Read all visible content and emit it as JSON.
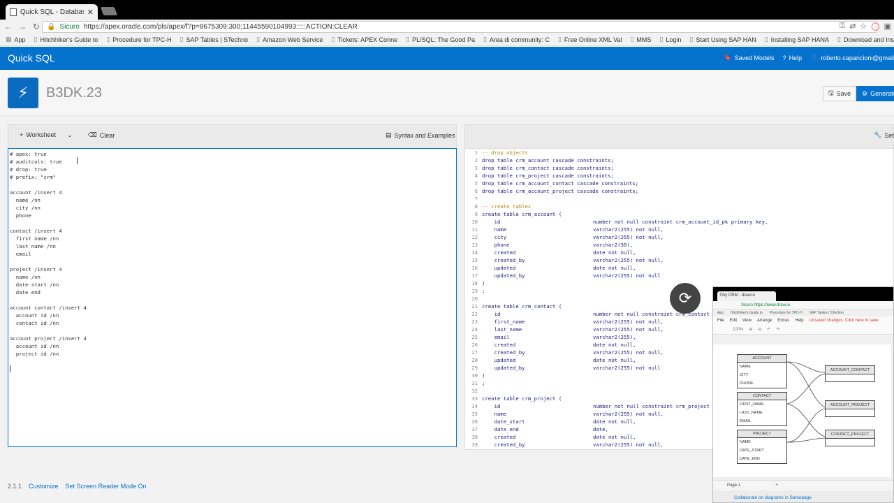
{
  "browser": {
    "tab_title": "Quick SQL - Database To",
    "secure_label": "Sicuro",
    "url": "https://apex.oracle.com/pls/apex/f?p=8675309:300:11445590104993:::::ACTION:CLEAR",
    "bookmarks": [
      "App",
      "Hitchhiker's Guide to",
      "Procedure for TPC-H",
      "SAP Tables | STechno",
      "Amazon Web Service",
      "Tickets: APEX Conne",
      "PL/SQL: The Good Pa",
      "Area di community: C",
      "Free Online XML Val",
      "MMS",
      "Login",
      "Start Using SAP HAN",
      "Installing SAP HANA",
      "Download and Instal"
    ]
  },
  "header": {
    "brand": "Quick SQL",
    "saved_models": "Saved Models",
    "help": "Help",
    "user": "roberto.capancioni@gmail"
  },
  "hero": {
    "title": "B3DK.23",
    "save_label": "Save",
    "generate_label": "Generate"
  },
  "left_toolbar": {
    "worksheet_label": "Worksheet",
    "clear_label": "Clear",
    "syntax_label": "Syntax and Examples"
  },
  "right_toolbar": {
    "settings_label": "Setti"
  },
  "editor": {
    "lines": [
      "# apex: true",
      "# auditcols: true",
      "# drop: true",
      "# prefix: \"crm\"",
      "",
      "account /insert 4",
      "  name /nn",
      "  city /nn",
      "  phone",
      "",
      "contact /insert 4",
      "  first name /nn",
      "  last name /nn",
      "  email",
      "",
      "project /insert 4",
      "  name /nn",
      "  date start /nn",
      "  date end",
      "",
      "account contact /insert 4",
      "  account id /nn",
      "  contact id /nn",
      "",
      "account project /insert 4",
      "  account id /nn",
      "  project id /nn"
    ]
  },
  "output": {
    "rows": [
      {
        "n": "1",
        "code": "-- drop objects",
        "type": "",
        "cls": "cm"
      },
      {
        "n": "2",
        "code": "drop table crm_account cascade constraints;",
        "type": "",
        "cls": ""
      },
      {
        "n": "3",
        "code": "drop table crm_contact cascade constraints;",
        "type": "",
        "cls": ""
      },
      {
        "n": "4",
        "code": "drop table crm_project cascade constraints;",
        "type": "",
        "cls": ""
      },
      {
        "n": "5",
        "code": "drop table crm_account_contact cascade constraints;",
        "type": "",
        "cls": ""
      },
      {
        "n": "6",
        "code": "drop table crm_account_project cascade constraints;",
        "type": "",
        "cls": ""
      },
      {
        "n": "7",
        "code": "",
        "type": "",
        "cls": ""
      },
      {
        "n": "8",
        "code": "-- create tables",
        "type": "",
        "cls": "cm"
      },
      {
        "n": "9",
        "code": "create table crm_account (",
        "type": "",
        "cls": ""
      },
      {
        "n": "10",
        "code": "    id",
        "type": "number not null constraint crm_account_id_pk primary key,",
        "cls": ""
      },
      {
        "n": "11",
        "code": "    name",
        "type": "varchar2(255) not null,",
        "cls": ""
      },
      {
        "n": "12",
        "code": "    city",
        "type": "varchar2(255) not null,",
        "cls": ""
      },
      {
        "n": "13",
        "code": "    phone",
        "type": "varchar2(30),",
        "cls": ""
      },
      {
        "n": "14",
        "code": "    created",
        "type": "date not null,",
        "cls": ""
      },
      {
        "n": "15",
        "code": "    created_by",
        "type": "varchar2(255) not null,",
        "cls": ""
      },
      {
        "n": "16",
        "code": "    updated",
        "type": "date not null,",
        "cls": ""
      },
      {
        "n": "17",
        "code": "    updated_by",
        "type": "varchar2(255) not null",
        "cls": ""
      },
      {
        "n": "18",
        "code": ")",
        "type": "",
        "cls": ""
      },
      {
        "n": "19",
        "code": ";",
        "type": "",
        "cls": ""
      },
      {
        "n": "20",
        "code": "",
        "type": "",
        "cls": ""
      },
      {
        "n": "21",
        "code": "create table crm_contact (",
        "type": "",
        "cls": ""
      },
      {
        "n": "22",
        "code": "    id",
        "type": "number not null constraint crm_contact",
        "cls": ""
      },
      {
        "n": "23",
        "code": "    first_name",
        "type": "varchar2(255) not null,",
        "cls": ""
      },
      {
        "n": "24",
        "code": "    last_name",
        "type": "varchar2(255) not null,",
        "cls": ""
      },
      {
        "n": "25",
        "code": "    email",
        "type": "varchar2(255),",
        "cls": ""
      },
      {
        "n": "26",
        "code": "    created",
        "type": "date not null,",
        "cls": ""
      },
      {
        "n": "27",
        "code": "    created_by",
        "type": "varchar2(255) not null,",
        "cls": ""
      },
      {
        "n": "28",
        "code": "    updated",
        "type": "date not null,",
        "cls": ""
      },
      {
        "n": "29",
        "code": "    updated_by",
        "type": "varchar2(255) not null",
        "cls": ""
      },
      {
        "n": "30",
        "code": ")",
        "type": "",
        "cls": ""
      },
      {
        "n": "31",
        "code": ";",
        "type": "",
        "cls": ""
      },
      {
        "n": "32",
        "code": "",
        "type": "",
        "cls": ""
      },
      {
        "n": "33",
        "code": "create table crm_project (",
        "type": "",
        "cls": ""
      },
      {
        "n": "34",
        "code": "    id",
        "type": "number not null constraint crm_project",
        "cls": ""
      },
      {
        "n": "35",
        "code": "    name",
        "type": "varchar2(255) not null,",
        "cls": ""
      },
      {
        "n": "36",
        "code": "    date_start",
        "type": "date not null,",
        "cls": ""
      },
      {
        "n": "37",
        "code": "    date_end",
        "type": "date,",
        "cls": ""
      },
      {
        "n": "38",
        "code": "    created",
        "type": "date not null,",
        "cls": ""
      },
      {
        "n": "39",
        "code": "    created_by",
        "type": "varchar2(255) not null,",
        "cls": ""
      }
    ]
  },
  "footer": {
    "version": "2.1.1",
    "customize": "Customize",
    "screen_reader": "Set Screen Reader Mode On"
  },
  "pip": {
    "tab_title": "Tiny CRM - draw.io",
    "url": "Sicuro  https://www.draw.io",
    "bookmarks": [
      "App",
      "Hitchhiker's Guide to",
      "Procedure for TPC-H",
      "SAP Tables | STechno"
    ],
    "menu": [
      "File",
      "Edit",
      "View",
      "Arrange",
      "Extras",
      "Help"
    ],
    "unsaved": "Unsaved changes. Click here to save.",
    "zoom": "100%",
    "entities": [
      {
        "name": "ACCOUNT",
        "fields": [
          "NAME",
          "CITY",
          "PHONE"
        ]
      },
      {
        "name": "CONTACT",
        "fields": [
          "FIRST_NAME",
          "LAST_NAME",
          "EMAIL"
        ]
      },
      {
        "name": "PROJECT",
        "fields": [
          "NAME",
          "DATE_START",
          "DATE_END"
        ]
      }
    ],
    "relations": [
      "ACCOUNT_CONTACT",
      "ACCOUNT_PROJECT",
      "CONTACT_PROJECT"
    ],
    "page": "Page-1",
    "collab": "Collaborate on diagrams in Samepage"
  }
}
